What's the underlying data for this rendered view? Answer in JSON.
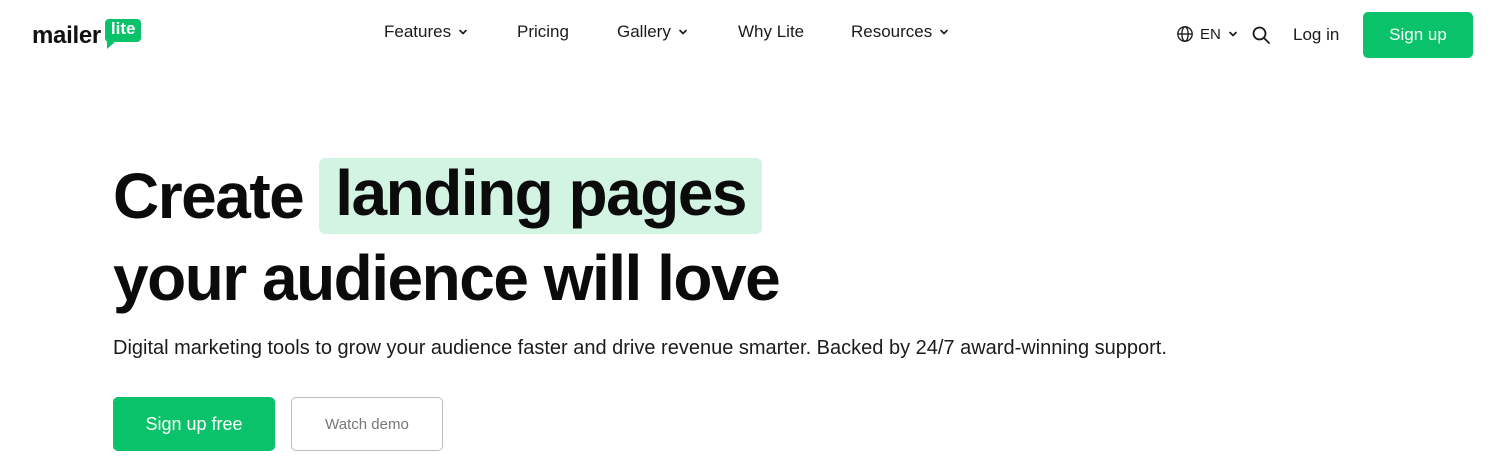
{
  "brand": {
    "name": "mailer",
    "badge": "lite",
    "accent_color": "#09c269",
    "highlight_color": "#d3f4e3"
  },
  "nav": {
    "items": [
      {
        "label": "Features",
        "has_dropdown": true
      },
      {
        "label": "Pricing",
        "has_dropdown": false
      },
      {
        "label": "Gallery",
        "has_dropdown": true
      },
      {
        "label": "Why Lite",
        "has_dropdown": false
      },
      {
        "label": "Resources",
        "has_dropdown": true
      }
    ]
  },
  "header": {
    "language": "EN",
    "login_label": "Log in",
    "signup_label": "Sign up",
    "icons": [
      "globe-icon",
      "chevron-down-icon",
      "search-icon"
    ]
  },
  "hero": {
    "title_prefix": "Create",
    "title_highlight": "landing pages",
    "title_line2": "your audience will love",
    "subtitle": "Digital marketing tools to grow your audience faster and drive revenue smarter. Backed by 24/7 award-winning support.",
    "primary_cta": "Sign up free",
    "secondary_cta": "Watch demo"
  }
}
